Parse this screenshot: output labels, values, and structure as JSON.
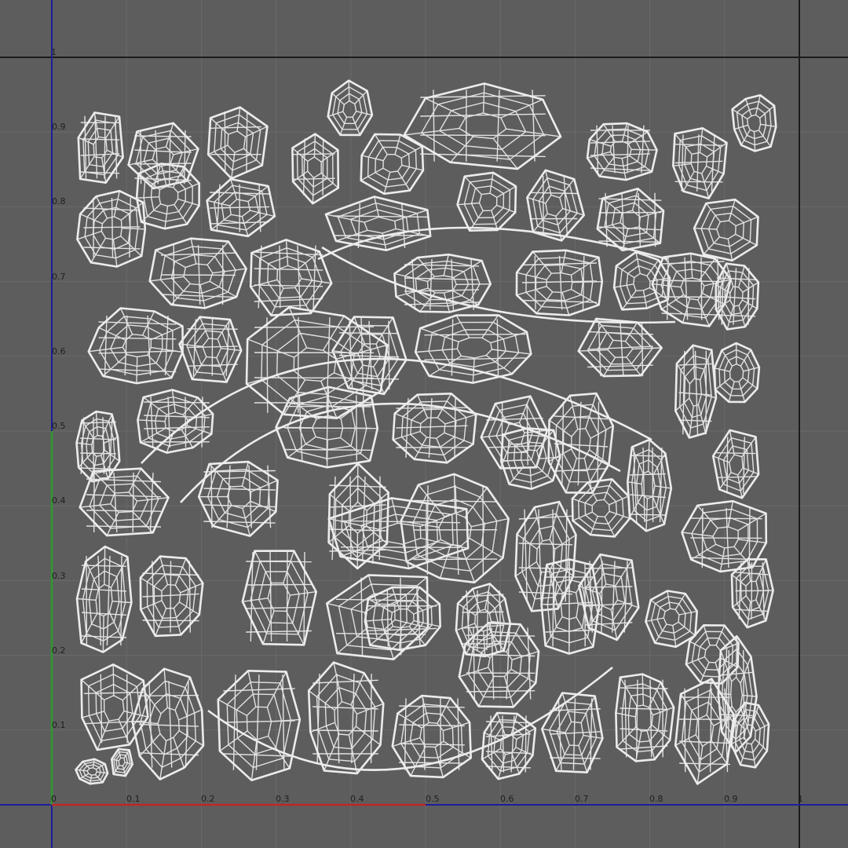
{
  "viewport": {
    "background": "#5d5d5d",
    "grid_color": "#6a6a6a",
    "frame_color": "#1c1c1c",
    "wire_color": "#e2e2e2"
  },
  "axes": {
    "u_axis_color": "#c02626",
    "v_axis_color": "#2e9a2e",
    "frame_axis_color": "#1d1d9c",
    "origin_label": "0",
    "u_ticks": [
      "0.1",
      "0.2",
      "0.3",
      "0.4",
      "0.5",
      "0.6",
      "0.7",
      "0.8",
      "0.9"
    ],
    "u_end_label": "1",
    "v_ticks": [
      "0.1",
      "0.2",
      "0.3",
      "0.4",
      "0.5",
      "0.6",
      "0.7",
      "0.8",
      "0.9"
    ],
    "v_end_label": "1"
  },
  "uv_layout": {
    "description_icon": "uv-shell-icon"
  }
}
